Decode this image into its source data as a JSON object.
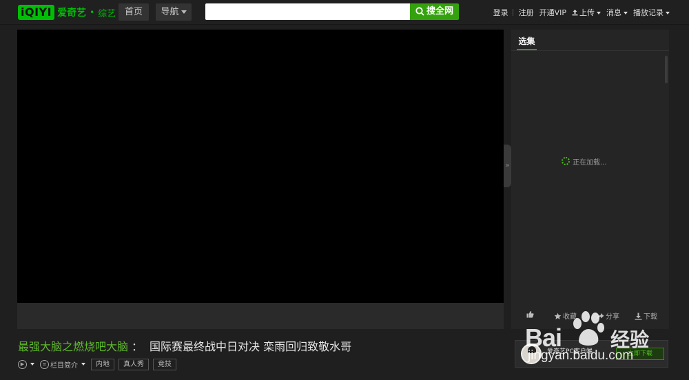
{
  "header": {
    "logo_badge": "iQIYI",
    "logo_text": "爱奇艺",
    "logo_dot": "•",
    "logo_channel": "综艺",
    "nav_home": "首页",
    "nav_guide": "导航",
    "search_value": "",
    "search_button": "搜全网",
    "login": "登录",
    "register": "注册",
    "open_vip": "开通VIP",
    "upload": "上传",
    "messages": "消息",
    "history": "播放记录"
  },
  "sidebar": {
    "tab_episodes": "选集",
    "loading_text": "正在加载...",
    "like": "",
    "favorite": "收藏",
    "share": "分享",
    "download": "下载"
  },
  "video": {
    "show_name": "最强大脑之燃烧吧大脑",
    "colon": "：",
    "episode_title": "国际赛最终战中日对决 栾雨回归致敬水哥",
    "intro_label": "栏目简介",
    "tags": [
      "内地",
      "真人秀",
      "竞技"
    ]
  },
  "promo": {
    "title": "爱奇艺PC客户端",
    "subtitle": "",
    "button": "立即下载"
  },
  "watermark": {
    "brand": "Bai",
    "brand_cn": "经验",
    "url": "jingyan.baidu.com"
  },
  "colors": {
    "accent_green": "#00be06",
    "search_green": "#34a20d",
    "show_name_green": "#5fbb2c"
  }
}
